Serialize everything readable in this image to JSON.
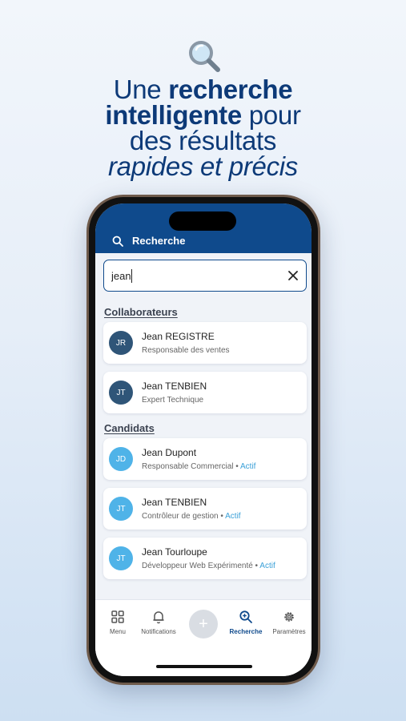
{
  "promo": {
    "icon": "magnifier-icon",
    "line1_pre": "Une ",
    "line1_bold": "recherche",
    "line2_bold": "intelligente",
    "line2_post": " pour",
    "line3": "des résultats",
    "line4": "rapides et précis"
  },
  "colors": {
    "brand": "#0f4a8c",
    "avatar_collaborator": "#2f5578",
    "avatar_candidate": "#4fb3e8",
    "status_active": "#3aa0d8"
  },
  "app": {
    "title": "Recherche",
    "title_icon": "search-icon"
  },
  "search": {
    "value": "jean",
    "clear_icon": "close-icon"
  },
  "collaborators": {
    "title": "Collaborateurs",
    "items": [
      {
        "initials": "JR",
        "name": "Jean REGISTRE",
        "role": "Responsable des ventes"
      },
      {
        "initials": "JT",
        "name": "Jean TENBIEN",
        "role": "Expert Technique"
      }
    ]
  },
  "candidates": {
    "title": "Candidats",
    "items": [
      {
        "initials": "JD",
        "name": "Jean Dupont",
        "role": "Responsable Commercial",
        "separator": " • ",
        "status": "Actif"
      },
      {
        "initials": "JT",
        "name": "Jean TENBIEN",
        "role": "Contrôleur de gestion",
        "separator": " • ",
        "status": "Actif"
      },
      {
        "initials": "JT",
        "name": "Jean Tourloupe",
        "role": "Développeur Web Expérimenté",
        "separator": " • ",
        "status": "Actif"
      }
    ]
  },
  "tabs": [
    {
      "label": "Menu",
      "icon": "grid-icon"
    },
    {
      "label": "Notifications",
      "icon": "bell-icon"
    },
    {
      "label": "",
      "icon": "plus-icon"
    },
    {
      "label": "Recherche",
      "icon": "search-icon",
      "active": true
    },
    {
      "label": "Paramètres",
      "icon": "gear-icon"
    }
  ]
}
